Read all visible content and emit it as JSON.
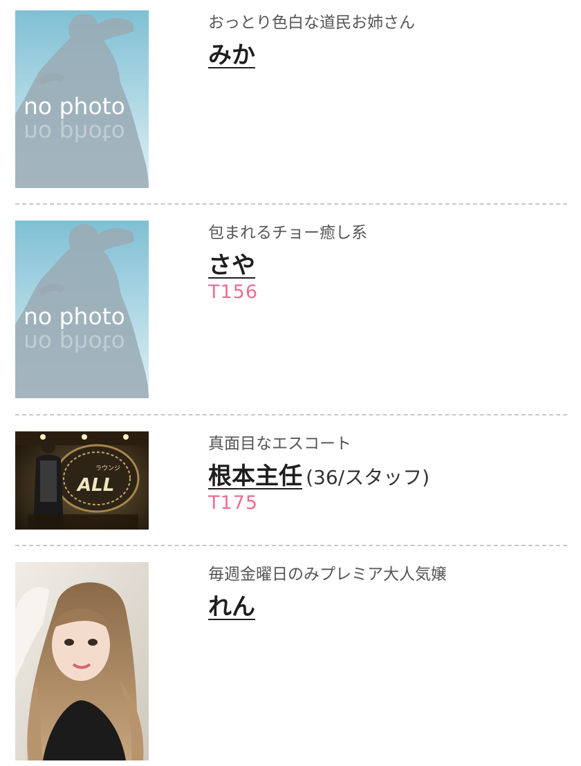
{
  "casts": [
    {
      "catch_copy": "おっとり色白な道民お姉さん",
      "name": "みか",
      "meta": "",
      "height": "",
      "photo": "no-photo-placeholder"
    },
    {
      "catch_copy": "包まれるチョー癒し系",
      "name": "さや",
      "meta": "",
      "height": "T156",
      "photo": "no-photo-placeholder"
    },
    {
      "catch_copy": "真面目なエスコート",
      "name": "根本主任",
      "meta": "(36/スタッフ)",
      "height": "T175",
      "photo": "staff-photo"
    },
    {
      "catch_copy": "毎週金曜日のみプレミア大人気嬢",
      "name": "れん",
      "meta": "",
      "height": "",
      "photo": "cast-photo"
    }
  ],
  "placeholder_text": "no photo",
  "lounge_sign": {
    "small": "ラウンジ",
    "brand": "ALL"
  },
  "colors": {
    "height": "#ef6d8f",
    "divider": "#c8c8c8",
    "name": "#1e1e1e"
  }
}
